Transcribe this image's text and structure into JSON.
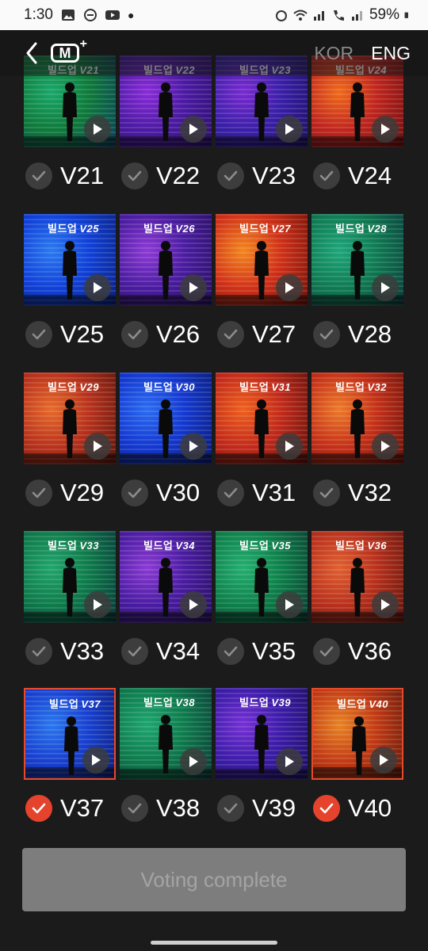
{
  "status_bar": {
    "time": "1:30",
    "battery": "59%"
  },
  "header": {
    "logo_text": "M",
    "logo_plus": "+",
    "lang_kor": "KOR",
    "lang_eng": "ENG"
  },
  "tag_prefix": "빌드업",
  "cards": [
    {
      "label": "V21",
      "selected": false,
      "colors": [
        "#0e7a3a",
        "#1aa86a",
        "#0a3d5c"
      ]
    },
    {
      "label": "V22",
      "selected": false,
      "colors": [
        "#4b1aa3",
        "#8a2bd8",
        "#2b0f6a"
      ]
    },
    {
      "label": "V23",
      "selected": false,
      "colors": [
        "#3a1fa8",
        "#7a2ad0",
        "#1c0f63"
      ]
    },
    {
      "label": "V24",
      "selected": false,
      "colors": [
        "#c0251e",
        "#f06a1a",
        "#6a0e0e"
      ]
    },
    {
      "label": "V25",
      "selected": false,
      "colors": [
        "#1040d8",
        "#2b7af0",
        "#0a1f7a"
      ]
    },
    {
      "label": "V26",
      "selected": false,
      "colors": [
        "#4a1ca0",
        "#8e3ad6",
        "#26105e"
      ]
    },
    {
      "label": "V27",
      "selected": false,
      "colors": [
        "#d03018",
        "#f4871e",
        "#6e1108"
      ]
    },
    {
      "label": "V28",
      "selected": false,
      "colors": [
        "#0f7a52",
        "#1ea67a",
        "#0a3a3a"
      ]
    },
    {
      "label": "V29",
      "selected": false,
      "colors": [
        "#b8321c",
        "#e86a2a",
        "#5a140c"
      ]
    },
    {
      "label": "V30",
      "selected": false,
      "colors": [
        "#1438d0",
        "#2a6cf2",
        "#0a1a70"
      ]
    },
    {
      "label": "V31",
      "selected": false,
      "colors": [
        "#c22a1a",
        "#f0601c",
        "#5c0f0a"
      ]
    },
    {
      "label": "V32",
      "selected": false,
      "colors": [
        "#c43018",
        "#ee7a28",
        "#640f0a"
      ]
    },
    {
      "label": "V33",
      "selected": false,
      "colors": [
        "#0e7a4a",
        "#22a66e",
        "#08363a"
      ]
    },
    {
      "label": "V34",
      "selected": false,
      "colors": [
        "#4a1ca2",
        "#8c3ad4",
        "#25105c"
      ]
    },
    {
      "label": "V35",
      "selected": false,
      "colors": [
        "#0e804a",
        "#24b070",
        "#0a3a30"
      ]
    },
    {
      "label": "V36",
      "selected": false,
      "colors": [
        "#b8301c",
        "#e26030",
        "#5c140c"
      ]
    },
    {
      "label": "V37",
      "selected": true,
      "colors": [
        "#1840d0",
        "#2a78ee",
        "#0c1c74"
      ]
    },
    {
      "label": "V38",
      "selected": false,
      "colors": [
        "#0e7a4c",
        "#1ea670",
        "#0a3836"
      ]
    },
    {
      "label": "V39",
      "selected": false,
      "colors": [
        "#3c1ca8",
        "#7630d6",
        "#1d0f62"
      ]
    },
    {
      "label": "V40",
      "selected": true,
      "colors": [
        "#c23a14",
        "#e88424",
        "#5c180a"
      ]
    }
  ],
  "vote_button": {
    "label": "Voting complete"
  }
}
